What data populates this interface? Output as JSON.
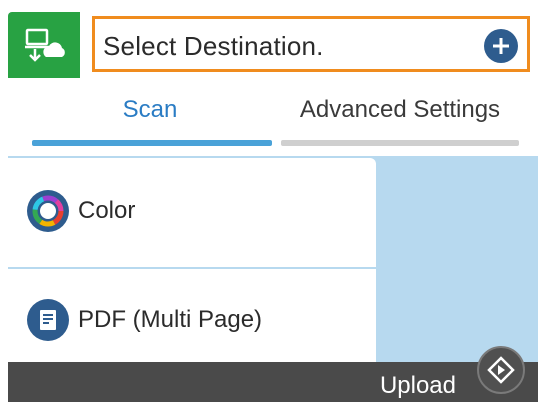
{
  "header": {
    "app_icon": "scan-to-cloud-icon",
    "destination_placeholder": "Select Destination.",
    "add_icon": "plus-icon"
  },
  "tabs": [
    {
      "label": "Scan",
      "selected": true
    },
    {
      "label": "Advanced Settings",
      "selected": false
    }
  ],
  "items": [
    {
      "label": "Color",
      "icon": "color-wheel-icon"
    },
    {
      "label": "PDF (Multi Page)",
      "icon": "pdf-document-icon"
    }
  ],
  "footer": {
    "upload_label": "Upload",
    "start_icon": "start-diamond-icon"
  },
  "colors": {
    "app_green": "#28a243",
    "highlight_orange": "#f08c1e",
    "tab_blue": "#2a7cc4",
    "accent_navy": "#2e5c8e",
    "panel_blue": "#b7d9ef"
  }
}
